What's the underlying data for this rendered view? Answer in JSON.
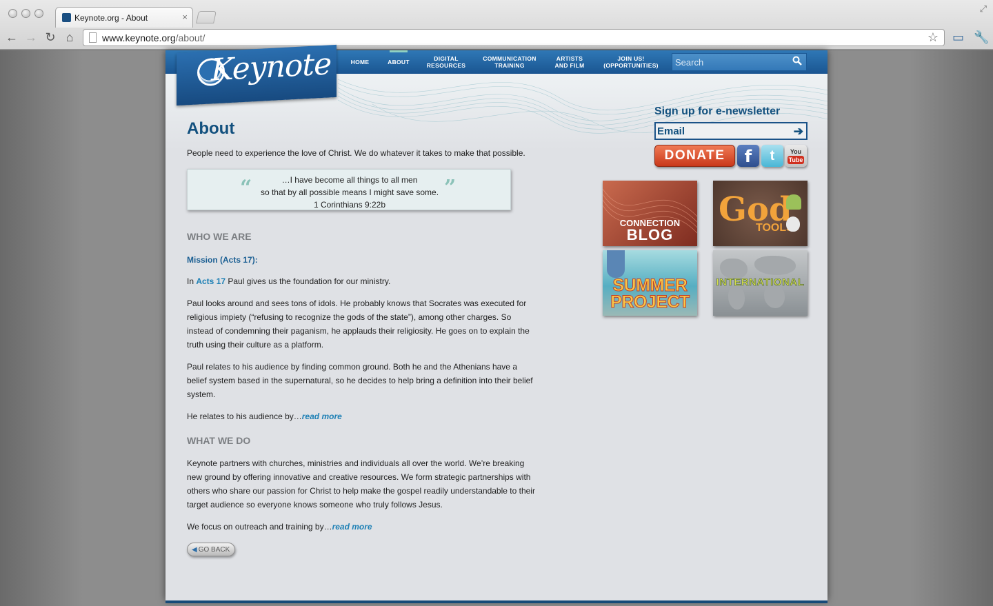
{
  "browser": {
    "tab_title": "Keynote.org - About",
    "close_glyph": "×",
    "url_host": "www.keynote.org",
    "url_path": "/about/",
    "icons": [
      "back-icon",
      "forward-icon",
      "reload-icon",
      "home-icon",
      "bookmark-star-icon",
      "extension-icon",
      "wrench-icon",
      "fullscreen-icon"
    ]
  },
  "site": {
    "logo_text": "Keynote",
    "nav": [
      {
        "line1": "HOME",
        "line2": ""
      },
      {
        "line1": "ABOUT",
        "line2": ""
      },
      {
        "line1": "DIGITAL",
        "line2": "RESOURCES"
      },
      {
        "line1": "COMMUNICATION",
        "line2": "TRAINING"
      },
      {
        "line1": "ARTISTS",
        "line2": "AND FILM"
      },
      {
        "line1": "JOIN US!",
        "line2": "(OPPORTUNITIES)"
      }
    ],
    "active_nav": "ABOUT",
    "search_placeholder": "Search"
  },
  "main": {
    "title": "About",
    "intro": "People need to experience the love of Christ. We do whatever it takes to make that possible.",
    "quote": {
      "open_mark": "“",
      "close_mark": "”",
      "line1": "…I have become all things to all men",
      "line2": "so that by all possible means I might save some.",
      "citation": "1 Corinthians 9:22b"
    },
    "who_we_are": {
      "heading": "WHO WE ARE",
      "mission_heading": "Mission (Acts 17):",
      "p1_before": "In ",
      "p1_link": "Acts 17",
      "p1_after": " Paul gives us the foundation for our ministry.",
      "p2": "Paul looks around and sees tons of idols. He probably knows that Socrates was executed for religious impiety (“refusing to recognize the gods of the state”), among other charges. So instead of condemning their paganism, he applauds their religiosity. He goes on to explain the truth using their culture as a platform.",
      "p3": "Paul relates to his audience by finding common ground. Both he and the Athenians have a belief system based in the supernatural, so he decides to help bring a definition into their belief system.",
      "p4_text": "He relates to his audience by…",
      "p4_link": "read more"
    },
    "what_we_do": {
      "heading": "WHAT WE DO",
      "p1": "Keynote partners with churches, ministries and individuals all over the world. We’re breaking new ground by offering innovative and creative resources. We form strategic partnerships with others who share our passion for Christ to help make the gospel readily understandable to their target audience so everyone knows someone who truly follows Jesus.",
      "p2_text": "We focus on outreach and training by…",
      "p2_link": "read more"
    },
    "go_back": "GO BACK"
  },
  "sidebar": {
    "signup_title": "Sign up for e-newsletter",
    "email_placeholder": "Email",
    "donate": "DONATE",
    "social": {
      "facebook": "f",
      "twitter": "t",
      "youtube_you": "You",
      "youtube_tube": "Tube"
    },
    "tiles": {
      "connection_a": "CONNECTION",
      "connection_b": "BLOG",
      "godtools_a": "God",
      "godtools_b": "TOOLS",
      "summer_a": "SUMMER",
      "summer_b": "PROJECT",
      "international": "INTERNATIONAL"
    }
  },
  "colors": {
    "brand_blue": "#12507e",
    "nav_blue": "#1a5591",
    "link_blue": "#1e80b5",
    "donate_orange": "#e05a35",
    "quote_teal": "#8bc2b8"
  }
}
